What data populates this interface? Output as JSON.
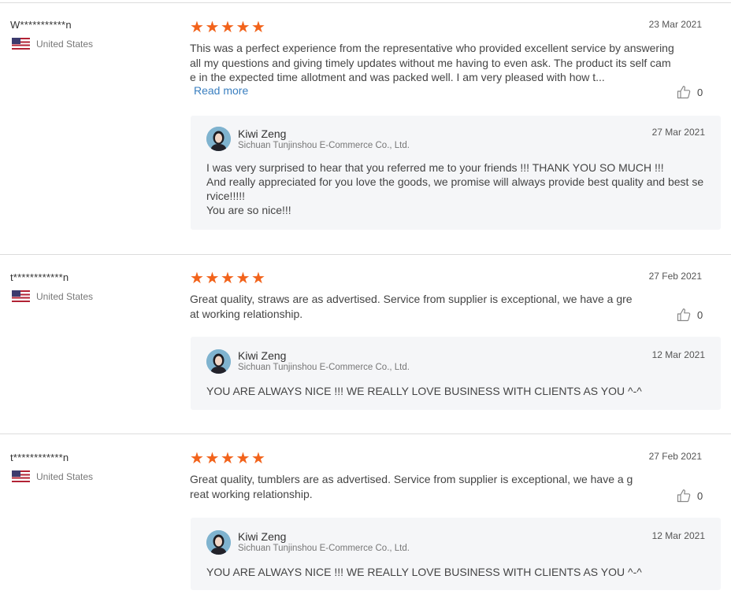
{
  "reviews": [
    {
      "reviewer": "W***********n",
      "country": "United States",
      "rating": 5,
      "date": "23 Mar 2021",
      "text": "This was a perfect experience from the representative who provided excellent service by answering all my questions and giving timely updates  without me having to even ask. The product its self came in the expected time allotment and was packed well.  I am very pleased with how t...",
      "read_more": "Read more",
      "likes": "0",
      "reply": {
        "seller_name": "Kiwi Zeng",
        "company": "Sichuan Tunjinshou E-Commerce Co., Ltd.",
        "date": "27 Mar 2021",
        "text": "I was very surprised to hear that you referred me to your friends !!! THANK YOU SO MUCH !!!\nAnd really appreciated for you love the goods, we promise will always provide best quality and best service!!!!!\nYou are so nice!!!"
      }
    },
    {
      "reviewer": "t************n",
      "country": "United States",
      "rating": 5,
      "date": "27 Feb 2021",
      "text": "Great quality, straws are as advertised. Service from supplier is exceptional, we have a great working relationship.",
      "likes": "0",
      "reply": {
        "seller_name": "Kiwi Zeng",
        "company": "Sichuan Tunjinshou E-Commerce Co., Ltd.",
        "date": "12 Mar 2021",
        "text": "YOU ARE ALWAYS NICE !!! WE REALLY LOVE BUSINESS WITH CLIENTS AS YOU ^-^"
      }
    },
    {
      "reviewer": "t************n",
      "country": "United States",
      "rating": 5,
      "date": "27 Feb 2021",
      "text": "Great quality, tumblers are as advertised. Service from supplier is exceptional, we have a great working relationship.",
      "likes": "0",
      "reply": {
        "seller_name": "Kiwi Zeng",
        "company": "Sichuan Tunjinshou E-Commerce Co., Ltd.",
        "date": "12 Mar 2021",
        "text": "YOU ARE ALWAYS NICE !!! WE REALLY LOVE BUSINESS WITH CLIENTS AS YOU ^-^"
      }
    }
  ],
  "icons": {
    "flag": "us-flag-icon",
    "star": "star-icon",
    "like": "thumbs-up-icon",
    "avatar": "avatar"
  },
  "colors": {
    "star": "#f2631b",
    "link": "#3a7fc0",
    "reply_bg": "#f5f6f8",
    "divider": "#dcdcdc"
  }
}
